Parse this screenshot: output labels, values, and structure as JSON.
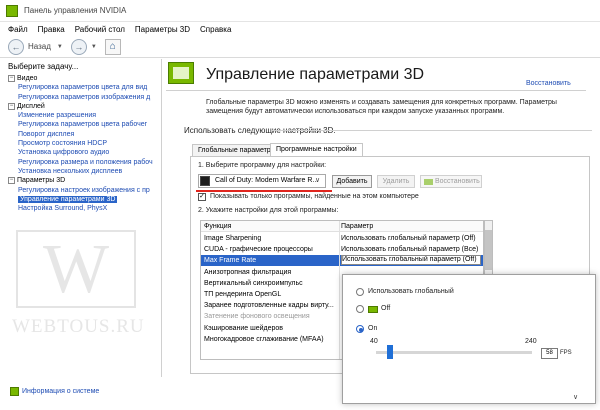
{
  "window": {
    "title": "Панель управления NVIDIA"
  },
  "menu": [
    "Файл",
    "Правка",
    "Рабочий стол",
    "Параметры 3D",
    "Справка"
  ],
  "toolbar": {
    "back_label": "Назад"
  },
  "sidebar": {
    "header": "Выберите задачу...",
    "tree": [
      {
        "kind": "cat",
        "label": "Видео"
      },
      {
        "kind": "item",
        "label": "Регулировка параметров цвета для вид"
      },
      {
        "kind": "item",
        "label": "Регулировка параметров изображения д"
      },
      {
        "kind": "cat",
        "label": "Дисплей"
      },
      {
        "kind": "item",
        "label": "Изменение разрешения"
      },
      {
        "kind": "item",
        "label": "Регулировка параметров цвета рабочег"
      },
      {
        "kind": "item",
        "label": "Поворот дисплея"
      },
      {
        "kind": "item",
        "label": "Просмотр состояния HDCP"
      },
      {
        "kind": "item",
        "label": "Установка цифрового аудио"
      },
      {
        "kind": "item",
        "label": "Регулировка размера и положения рабоч"
      },
      {
        "kind": "item",
        "label": "Установка нескольких дисплеев"
      },
      {
        "kind": "cat",
        "label": "Параметры 3D"
      },
      {
        "kind": "item",
        "label": "Регулировка настроек изображения с пр"
      },
      {
        "kind": "item",
        "label": "Управление параметрами 3D",
        "selected": true
      },
      {
        "kind": "item",
        "label": "Настройка Surround, PhysX"
      }
    ],
    "watermark_text": "WEBTOUS.RU",
    "status_link": "Информация о системе"
  },
  "main": {
    "title": "Управление параметрами 3D",
    "restore_link": "Восстановить",
    "description": "Глобальные параметры 3D можно изменять и создавать замещения для конкретных программ. Параметры замещения будут автоматически использоваться при каждом запуске указанных программ.",
    "section_title": "Использовать следующие настройки 3D.",
    "tabs": [
      {
        "label": "Глобальные параметры",
        "active": false
      },
      {
        "label": "Программные настройки",
        "active": true
      }
    ],
    "step1": "1. Выберите программу для настройки:",
    "program_selected": "Call of Duty: Modern Warfare R...",
    "btn_add": "Добавить",
    "btn_delete": "Удалить",
    "btn_restore": "Восстановить",
    "checkbox_label": "Показывать только программы, найденные на этом компьютере",
    "checkbox_checked": "✓",
    "step2": "2. Укажите настройки для этой программы:",
    "table": {
      "headers": [
        "Функция",
        "Параметр"
      ],
      "rows": [
        {
          "feature": "Image Sharpening",
          "value": "Использовать глобальный параметр (Off)"
        },
        {
          "feature": "CUDA - графические процессоры",
          "value": "Использовать глобальный параметр (Все)"
        },
        {
          "feature": "Max Frame Rate",
          "value": "Использовать глобальный параметр (Off)",
          "selected": true
        },
        {
          "feature": "Анизотропная фильтрация",
          "value": ""
        },
        {
          "feature": "Вертикальный синхроимпульс",
          "value": ""
        },
        {
          "feature": "ТП рендеринга OpenGL",
          "value": ""
        },
        {
          "feature": "Заранее подготовленные кадры вирту...",
          "value": ""
        },
        {
          "feature": "Затенение фонового освещения",
          "value": "",
          "grey": true
        },
        {
          "feature": "Кэширование шейдеров",
          "value": ""
        },
        {
          "feature": "Многокадровое сглаживание (MFAA)",
          "value": ""
        }
      ]
    }
  },
  "popup": {
    "option_global": "Использовать глобальный",
    "option_off": "Off",
    "option_on": "On",
    "selected_option": "On",
    "slider": {
      "min": 40,
      "max": 240,
      "value": 58
    },
    "fps_unit": "FPS"
  },
  "colors": {
    "accent": "#79b800",
    "selection": "#2a64c8",
    "link": "#1e4cb3",
    "underline": "#e0251e"
  },
  "icons": [
    "nvidia-icon",
    "back-arrow-icon",
    "forward-arrow-icon",
    "home-icon",
    "expand-box-icon",
    "info-icon",
    "program-icon",
    "dropdown-arrow-icon"
  ]
}
